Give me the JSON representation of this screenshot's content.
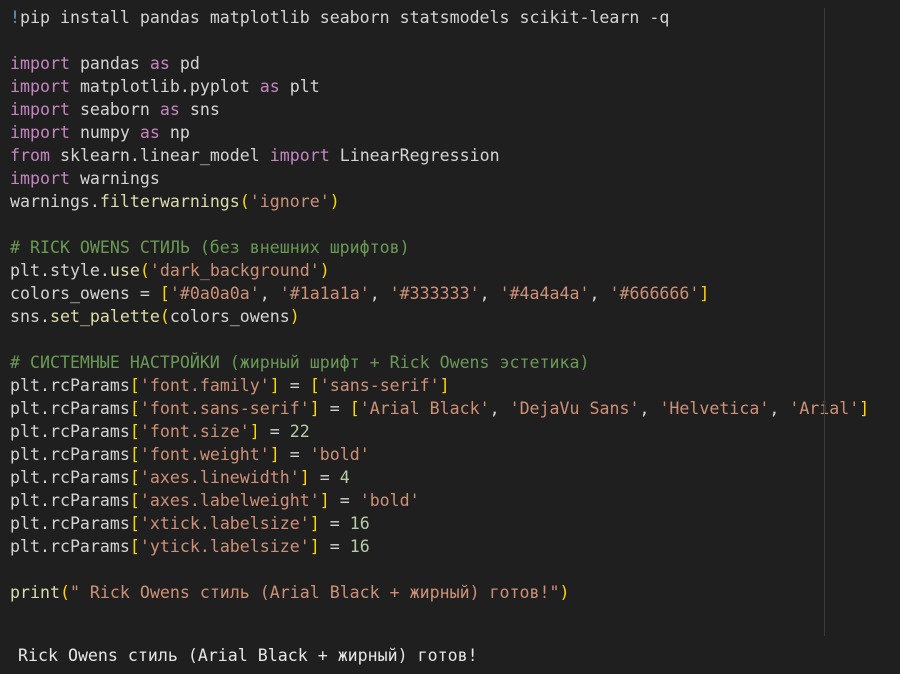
{
  "colors": {
    "background": "#1f1f1f",
    "keyword": "#c586c0",
    "string": "#ce9178",
    "number": "#b5cea8",
    "comment": "#6a9955",
    "function": "#dcdcaa",
    "bracket": "#ffd700",
    "text": "#d4d4d4"
  },
  "code_cell": {
    "lines": [
      [
        [
          "bang",
          "!"
        ],
        [
          "plain",
          "pip install pandas matplotlib seaborn statsmodels scikit-learn -q"
        ]
      ],
      [],
      [
        [
          "kw",
          "import"
        ],
        [
          "plain",
          " pandas "
        ],
        [
          "kw",
          "as"
        ],
        [
          "plain",
          " pd"
        ]
      ],
      [
        [
          "kw",
          "import"
        ],
        [
          "plain",
          " matplotlib.pyplot "
        ],
        [
          "kw",
          "as"
        ],
        [
          "plain",
          " plt"
        ]
      ],
      [
        [
          "kw",
          "import"
        ],
        [
          "plain",
          " seaborn "
        ],
        [
          "kw",
          "as"
        ],
        [
          "plain",
          " sns"
        ]
      ],
      [
        [
          "kw",
          "import"
        ],
        [
          "plain",
          " numpy "
        ],
        [
          "kw",
          "as"
        ],
        [
          "plain",
          " np"
        ]
      ],
      [
        [
          "kw",
          "from"
        ],
        [
          "plain",
          " sklearn.linear_model "
        ],
        [
          "kw",
          "import"
        ],
        [
          "plain",
          " LinearRegression"
        ]
      ],
      [
        [
          "kw",
          "import"
        ],
        [
          "plain",
          " warnings"
        ]
      ],
      [
        [
          "plain",
          "warnings."
        ],
        [
          "fn",
          "filterwarnings"
        ],
        [
          "bk1",
          "("
        ],
        [
          "str",
          "'ignore'"
        ],
        [
          "bk1",
          ")"
        ]
      ],
      [],
      [
        [
          "cmt",
          "# RICK OWENS СТИЛЬ (без внешних шрифтов)"
        ]
      ],
      [
        [
          "plain",
          "plt.style."
        ],
        [
          "fn",
          "use"
        ],
        [
          "bk1",
          "("
        ],
        [
          "str",
          "'dark_background'"
        ],
        [
          "bk1",
          ")"
        ]
      ],
      [
        [
          "plain",
          "colors_owens = "
        ],
        [
          "bk1",
          "["
        ],
        [
          "str",
          "'#0a0a0a'"
        ],
        [
          "plain",
          ", "
        ],
        [
          "str",
          "'#1a1a1a'"
        ],
        [
          "plain",
          ", "
        ],
        [
          "str",
          "'#333333'"
        ],
        [
          "plain",
          ", "
        ],
        [
          "str",
          "'#4a4a4a'"
        ],
        [
          "plain",
          ", "
        ],
        [
          "str",
          "'#666666'"
        ],
        [
          "bk1",
          "]"
        ]
      ],
      [
        [
          "plain",
          "sns."
        ],
        [
          "fn",
          "set_palette"
        ],
        [
          "bk1",
          "("
        ],
        [
          "plain",
          "colors_owens"
        ],
        [
          "bk1",
          ")"
        ]
      ],
      [],
      [
        [
          "cmt",
          "# СИСТЕМНЫЕ НАСТРОЙКИ (жирный шрифт + Rick Owens эстетика)"
        ]
      ],
      [
        [
          "plain",
          "plt.rcParams"
        ],
        [
          "bk1",
          "["
        ],
        [
          "str",
          "'font.family'"
        ],
        [
          "bk1",
          "]"
        ],
        [
          "plain",
          " = "
        ],
        [
          "bk1",
          "["
        ],
        [
          "str",
          "'sans-serif'"
        ],
        [
          "bk1",
          "]"
        ]
      ],
      [
        [
          "plain",
          "plt.rcParams"
        ],
        [
          "bk1",
          "["
        ],
        [
          "str",
          "'font.sans-serif'"
        ],
        [
          "bk1",
          "]"
        ],
        [
          "plain",
          " = "
        ],
        [
          "bk1",
          "["
        ],
        [
          "str",
          "'Arial Black'"
        ],
        [
          "plain",
          ", "
        ],
        [
          "str",
          "'DejaVu Sans'"
        ],
        [
          "plain",
          ", "
        ],
        [
          "str",
          "'Helvetica'"
        ],
        [
          "plain",
          ", "
        ],
        [
          "str",
          "'Arial'"
        ],
        [
          "bk1",
          "]"
        ]
      ],
      [
        [
          "plain",
          "plt.rcParams"
        ],
        [
          "bk1",
          "["
        ],
        [
          "str",
          "'font.size'"
        ],
        [
          "bk1",
          "]"
        ],
        [
          "plain",
          " = "
        ],
        [
          "num",
          "22"
        ]
      ],
      [
        [
          "plain",
          "plt.rcParams"
        ],
        [
          "bk1",
          "["
        ],
        [
          "str",
          "'font.weight'"
        ],
        [
          "bk1",
          "]"
        ],
        [
          "plain",
          " = "
        ],
        [
          "str",
          "'bold'"
        ]
      ],
      [
        [
          "plain",
          "plt.rcParams"
        ],
        [
          "bk1",
          "["
        ],
        [
          "str",
          "'axes.linewidth'"
        ],
        [
          "bk1",
          "]"
        ],
        [
          "plain",
          " = "
        ],
        [
          "num",
          "4"
        ]
      ],
      [
        [
          "plain",
          "plt.rcParams"
        ],
        [
          "bk1",
          "["
        ],
        [
          "str",
          "'axes.labelweight'"
        ],
        [
          "bk1",
          "]"
        ],
        [
          "plain",
          " = "
        ],
        [
          "str",
          "'bold'"
        ]
      ],
      [
        [
          "plain",
          "plt.rcParams"
        ],
        [
          "bk1",
          "["
        ],
        [
          "str",
          "'xtick.labelsize'"
        ],
        [
          "bk1",
          "]"
        ],
        [
          "plain",
          " = "
        ],
        [
          "num",
          "16"
        ]
      ],
      [
        [
          "plain",
          "plt.rcParams"
        ],
        [
          "bk1",
          "["
        ],
        [
          "str",
          "'ytick.labelsize'"
        ],
        [
          "bk1",
          "]"
        ],
        [
          "plain",
          " = "
        ],
        [
          "num",
          "16"
        ]
      ],
      [],
      [
        [
          "fn",
          "print"
        ],
        [
          "bk1",
          "("
        ],
        [
          "str",
          "\" Rick Owens стиль (Arial Black + жирный) готов!\""
        ],
        [
          "bk1",
          ")"
        ]
      ]
    ]
  },
  "output": {
    "text": "Rick Owens стиль (Arial Black + жирный) готов!"
  }
}
